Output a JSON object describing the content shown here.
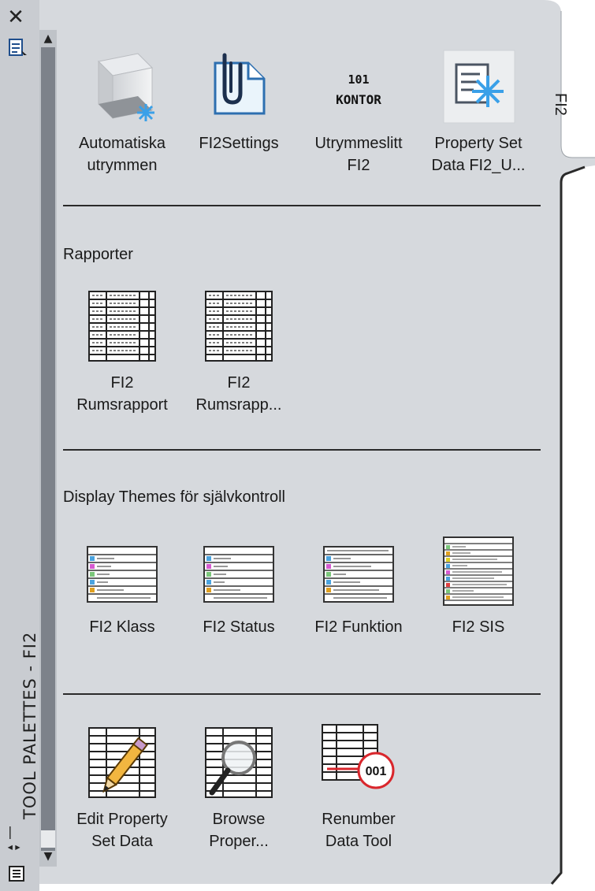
{
  "palette": {
    "vertical_title": "TOOL PALETTES - FI2",
    "tab_label": "FI2",
    "close_glyph": "✕",
    "autohide_glyph": "|◂▸"
  },
  "sections": {
    "top": {
      "tools": [
        {
          "line1": "Automatiska",
          "line2": "utrymmen",
          "icon": "space-cube-icon"
        },
        {
          "line1": "FI2Settings",
          "line2": "",
          "icon": "paperclip-document-icon"
        },
        {
          "line1": "Utrymmeslitt",
          "line2": "FI2",
          "icon": "space-tag-icon",
          "tag_number": "101",
          "tag_name": "KONTOR"
        },
        {
          "line1": "Property Set",
          "line2": "Data FI2_U...",
          "icon": "property-set-icon"
        }
      ]
    },
    "reports": {
      "title": "Rapporter",
      "tools": [
        {
          "line1": "FI2",
          "line2": "Rumsrapport",
          "icon": "table-report-icon"
        },
        {
          "line1": "FI2",
          "line2": "Rumsrapp...",
          "icon": "table-report-icon"
        }
      ]
    },
    "themes": {
      "title": "Display Themes för självkontroll",
      "tools": [
        {
          "line1": "FI2 Klass",
          "icon": "display-theme-icon"
        },
        {
          "line1": "FI2 Status",
          "icon": "display-theme-icon"
        },
        {
          "line1": "FI2 Funktion",
          "icon": "display-theme-icon"
        },
        {
          "line1": "FI2 SIS",
          "icon": "display-theme-icon"
        }
      ]
    },
    "data_tools": {
      "tools": [
        {
          "line1": "Edit Property",
          "line2": "Set Data",
          "icon": "edit-pencil-table-icon"
        },
        {
          "line1": "Browse",
          "line2": "Proper...",
          "icon": "magnifier-table-icon"
        },
        {
          "line1": "Renumber",
          "line2": "Data Tool",
          "icon": "renumber-table-icon",
          "badge": "001"
        }
      ]
    }
  },
  "colors": {
    "panel": "#d6d9dd",
    "strip": "#c9ccd1",
    "scroll_track": "#7d828a",
    "badge_ring": "#d9262c"
  }
}
